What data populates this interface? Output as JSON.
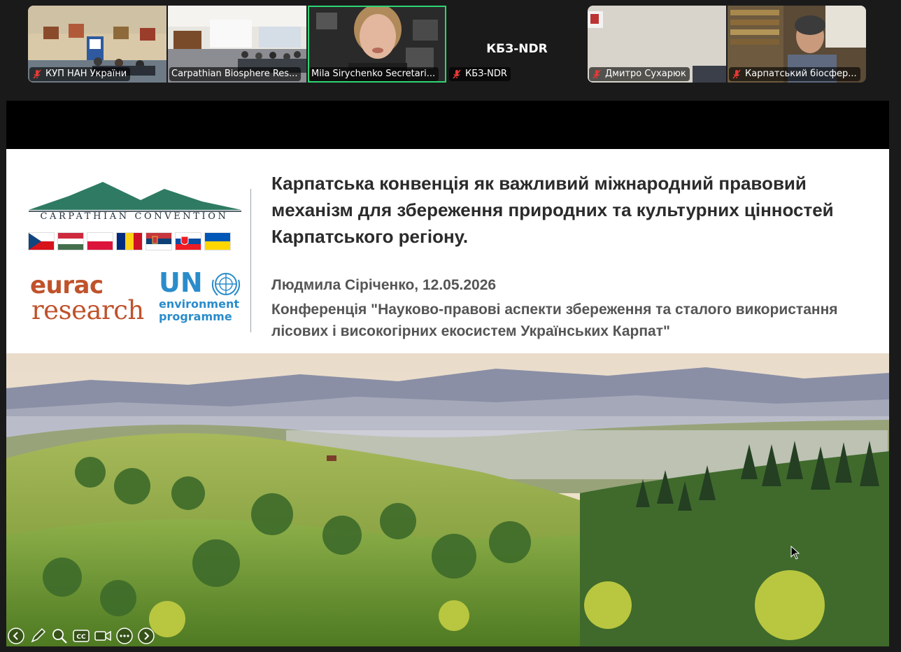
{
  "participants": [
    {
      "name": "КУП НАН України",
      "muted": true
    },
    {
      "name": "Carpathian Biosphere Res...",
      "muted": false
    },
    {
      "name": "Mila Sirychenko Secretari...",
      "muted": false,
      "speaking": true
    },
    {
      "name": "КБЗ-NDR",
      "muted": true,
      "display_name": "КБЗ-NDR"
    },
    {
      "name": "Дмитро Сухарюк",
      "muted": true
    },
    {
      "name": "Карпатський біосфер...",
      "muted": true
    }
  ],
  "slide": {
    "logo_text": "CARPATHIAN CONVENTION",
    "eurac_line1": "eurac",
    "eurac_line2": "research",
    "un_text": "UN",
    "unep_line1": "environment",
    "unep_line2": "programme",
    "title": "Карпатська конвенція як важливий міжнародний правовий механізм для збереження природних та культурних цінностей Карпатського регіону.",
    "author_date": "Людмила Сіріченко, 12.05.2026",
    "conference": "Конференція \"Науково-правові аспекти збереження та сталого використання лісових і високогірних екосистем Українських Карпат\""
  },
  "colors": {
    "active_speaker": "#2ed573",
    "mountain_green": "#2f7a63",
    "eurac_orange": "#c0522b",
    "unep_blue": "#2a8ccb",
    "muted_red": "#e53935"
  },
  "toolbar_icons": [
    "prev-slide-icon",
    "pen-icon",
    "zoom-icon",
    "captions-icon",
    "camera-icon",
    "more-icon",
    "next-slide-icon"
  ]
}
